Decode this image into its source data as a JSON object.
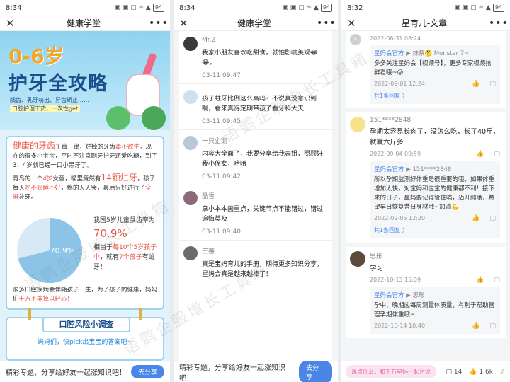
{
  "p1": {
    "time": "8:34",
    "title": "健康学堂",
    "hero": {
      "age": "0-6岁",
      "title": "护牙全攻略",
      "sub1": "龋齿、乳牙萌出、牙齿矫正……",
      "sub2": "口腔护理干货，一次性get"
    },
    "para1a": "健康的牙齿",
    "para1b": "千篇一律，烂掉的牙齿",
    "para1c": "毒不欲生",
    "para1d": "。现在的很多小宝宝，平时不注意刷牙护牙还爱吃糖，到了3、4岁就已经一口小黑牙了。",
    "para2a": "青岛的一个",
    "para2b": "4岁",
    "para2c": "女童，嘴里竟然有",
    "para2d": "14颗烂牙",
    "para2e": "，孩子每天",
    "para2f": "吃不好睡不好",
    "para2g": "，疼的天天哭，最后只好进行了",
    "para2h": "全麻",
    "para2i": "补牙。",
    "stat_title": "我国5岁儿童龋齿率为",
    "stat_pct": "70.9%",
    "pie_label": "70.9%",
    "pie_value": 70.9,
    "stat_d1": "相当于",
    "stat_d2": "每10个5岁孩子中",
    "stat_d3": "，就有",
    "stat_d4": "7个孩子",
    "stat_d5": "有蛀牙！",
    "bottom_a": "很多口腔疾病会伴随孩子一生，为了孩子的健康，妈妈们",
    "bottom_b": "千万不能掉以轻心！",
    "survey_title": "口腔风险小调查",
    "survey_q": "妈妈们，快pick出宝宝的答案吧~",
    "share_text": "精彩专题，分享给好友一起涨知识吧！",
    "share_btn": "去分享"
  },
  "p2": {
    "time": "8:34",
    "title": "健康学堂",
    "comments": [
      {
        "name": "Mr.Z",
        "text": "我家小朋友喜欢吃甜食，就怕影响美观😂😂。",
        "time": "03-11 09:47"
      },
      {
        "name": "",
        "text": "孩子蛀牙比例这么高吗？不说真没意识到啊，看来真得定期带孩子看牙科大夫",
        "time": "03-11 09:45"
      },
      {
        "name": "一只企鹅",
        "text": "内容大全面了，我要分享给我表姐，照顾好我小侄女，哈哈",
        "time": "03-11 09:42"
      },
      {
        "name": "晶雪",
        "text": "拿小本本画重点，关键节点不能错过，错过追悔莫及",
        "time": "03-11 09:40"
      },
      {
        "name": "三蕃",
        "text": "真是宝妈育儿的手册，期待更多知识分享，星妈会真是越来越棒了！",
        "time": ""
      }
    ],
    "share_text": "精彩专题，分享给好友一起涨知识吧！",
    "share_btn": "去分享"
  },
  "p3": {
    "time": "8:32",
    "title": "星育儿-文章",
    "top_time": "2022-08-31 08:24",
    "r1_name": "星妈会官方",
    "r1_arrow": "▶",
    "r1_to": "抹茶🤔 Monstar 7~",
    "r1_text": "多多关注星妈会【视频号】，更多专家视频抢鲜看哦~😜",
    "r1_time": "2022-09-01 12:24",
    "r1_more": "共1条回复 〉",
    "c1_name": "151****2848",
    "c1_text": "孕期太容易长肉了，没怎么吃，长了40斤，就就六斤多",
    "c1_time": "2022-09-04 09:59",
    "r2_name": "星妈会官方",
    "r2_to": "151****2848",
    "r2_text": "所以孕期监测好体重是很重要的哦，如果体重增加太快，对宝妈和宝宝的健康都不利！接下来的日子，星妈要记得管住嘴，迈开腿哦，希望早日恢复昔日身材哦~加油💪",
    "r2_time": "2022-09-05 12:20",
    "r2_more": "共1条回复 〉",
    "c2_name": "思彤",
    "c2_text": "学习",
    "c2_time": "2022-10-13 15:09",
    "r3_name": "星妈会官方",
    "r3_to": "思彤",
    "r3_text": "孕中、晚期应每周测量体质量，有利于帮助管理孕期体重哦~",
    "r3_time": "2022-10-14 10:40",
    "input_placeholder": "说点什么，和千万星妈一起讨论",
    "comments_count": "14",
    "likes_count": "1.6k"
  },
  "watermark": "语鹦企服增长工具箱"
}
